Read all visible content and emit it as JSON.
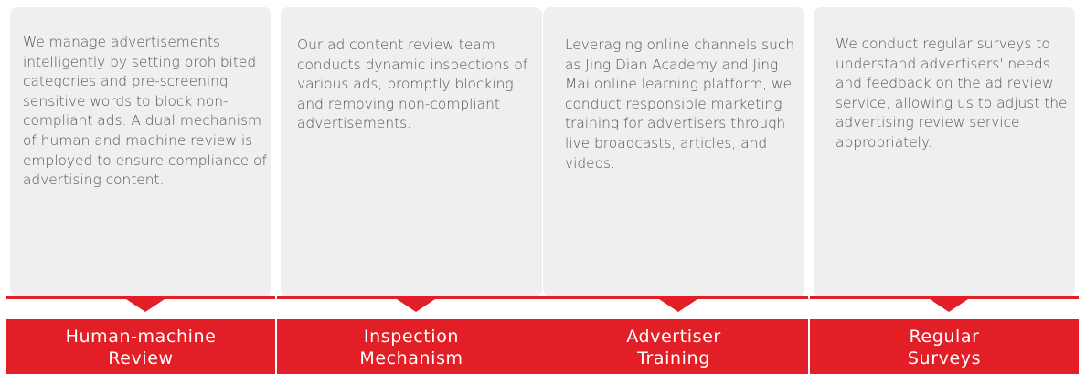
{
  "colors": {
    "card_background": "#efefef",
    "accent_red": "#e21f26",
    "body_text": "#555555",
    "label_text": "#ffffff"
  },
  "columns": [
    {
      "description": "We manage advertisements intelligently by setting prohibited categories and pre-screening sensitive words to block non-compliant ads. A dual mechanism of human and machine review is employed to ensure compliance of advertising content.",
      "title_line1": "Human-machine",
      "title_line2": "Review"
    },
    {
      "description": "Our ad content review team conducts dynamic inspections of various ads, promptly blocking and removing non-compliant advertisements.",
      "title_line1": "Inspection",
      "title_line2": "Mechanism"
    },
    {
      "description": "Leveraging online channels such as Jing Dian Academy and Jing Mai online learning platform, we conduct responsible marketing training for advertisers through live broadcasts, articles, and videos.",
      "title_line1": "Advertiser",
      "title_line2": "Training"
    },
    {
      "description": "We conduct regular surveys to understand advertisers' needs and feedback on the ad review service, allowing us to adjust the advertising review service appropriately.",
      "title_line1": "Regular",
      "title_line2": "Surveys"
    }
  ]
}
